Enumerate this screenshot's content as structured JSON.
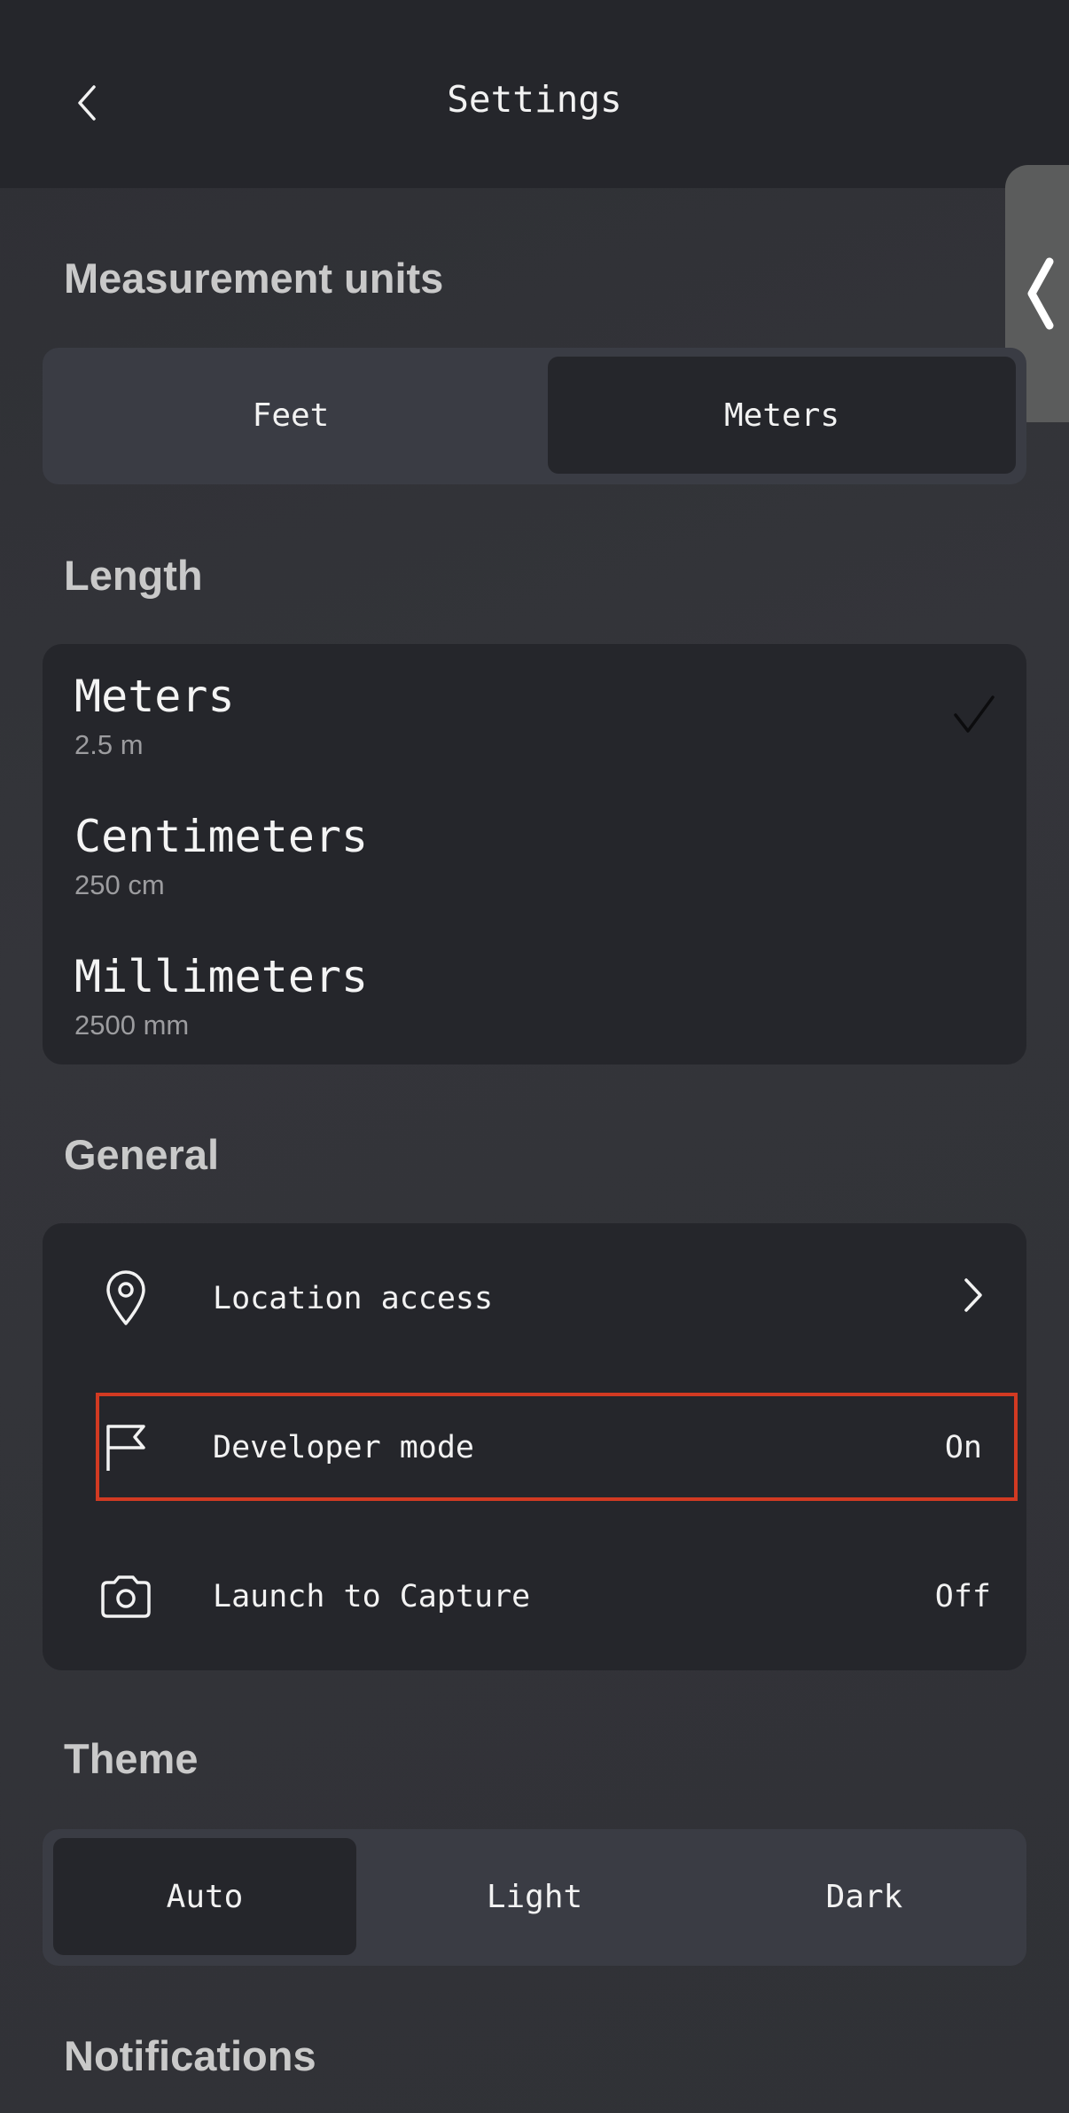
{
  "header": {
    "title": "Settings",
    "back_icon": "chevron-left-icon"
  },
  "side_handle": {
    "icon": "chevron-left-icon"
  },
  "measurement_units": {
    "title": "Measurement units",
    "options": [
      "Feet",
      "Meters"
    ],
    "selected": "Meters"
  },
  "length": {
    "title": "Length",
    "items": [
      {
        "name": "Meters",
        "example": "2.5 m",
        "selected": true
      },
      {
        "name": "Centimeters",
        "example": "250 cm",
        "selected": false
      },
      {
        "name": "Millimeters",
        "example": "2500 mm",
        "selected": false
      }
    ]
  },
  "general": {
    "title": "General",
    "items": [
      {
        "label": "Location access",
        "icon": "location-pin-icon",
        "trailing": "chevron-right-icon"
      },
      {
        "label": "Developer mode",
        "icon": "flag-icon",
        "value": "On",
        "highlighted": true
      },
      {
        "label": "Launch to Capture",
        "icon": "camera-icon",
        "value": "Off"
      }
    ]
  },
  "theme": {
    "title": "Theme",
    "options": [
      "Auto",
      "Light",
      "Dark"
    ],
    "selected": "Auto"
  },
  "notifications": {
    "title": "Notifications"
  },
  "colors": {
    "header_bg": "#25262b",
    "page_bg": "#303136",
    "card_bg": "#25262b",
    "segment_bg": "#3a3c44",
    "section_title": "#c9c9c9",
    "highlight_border": "#d23a22",
    "handle_bg": "#5b5c5c"
  }
}
